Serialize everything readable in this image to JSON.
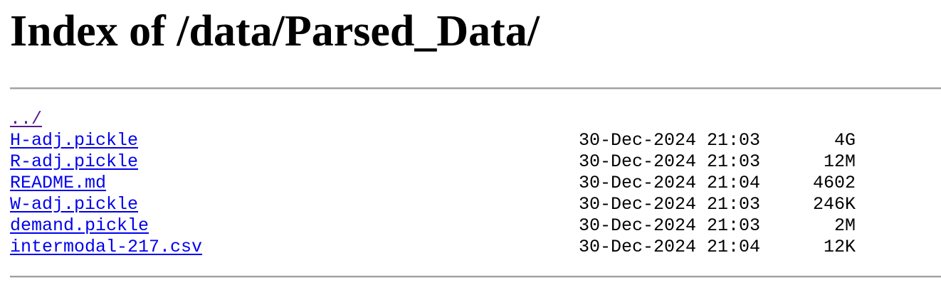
{
  "title": "Index of /data/Parsed_Data/",
  "colors": {
    "link": "#0000ee",
    "visited_link": "#551a8b",
    "rule": "#a0a0a0",
    "text": "#000000",
    "background": "#ffffff"
  },
  "parent_link": "../",
  "entries": [
    {
      "name": "H-adj.pickle",
      "date": "30-Dec-2024 21:03",
      "size": "4G"
    },
    {
      "name": "R-adj.pickle",
      "date": "30-Dec-2024 21:03",
      "size": "12M"
    },
    {
      "name": "README.md",
      "date": "30-Dec-2024 21:04",
      "size": "4602"
    },
    {
      "name": "W-adj.pickle",
      "date": "30-Dec-2024 21:03",
      "size": "246K"
    },
    {
      "name": "demand.pickle",
      "date": "30-Dec-2024 21:03",
      "size": "2M"
    },
    {
      "name": "intermodal-217.csv",
      "date": "30-Dec-2024 21:04",
      "size": "12K"
    }
  ]
}
